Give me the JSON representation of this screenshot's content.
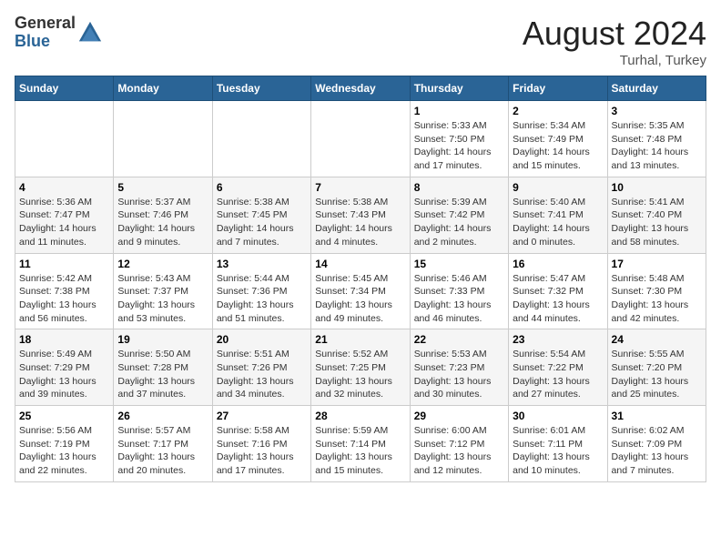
{
  "header": {
    "logo_general": "General",
    "logo_blue": "Blue",
    "month_year": "August 2024",
    "location": "Turhal, Turkey"
  },
  "weekdays": [
    "Sunday",
    "Monday",
    "Tuesday",
    "Wednesday",
    "Thursday",
    "Friday",
    "Saturday"
  ],
  "weeks": [
    [
      {
        "day": "",
        "info": ""
      },
      {
        "day": "",
        "info": ""
      },
      {
        "day": "",
        "info": ""
      },
      {
        "day": "",
        "info": ""
      },
      {
        "day": "1",
        "info": "Sunrise: 5:33 AM\nSunset: 7:50 PM\nDaylight: 14 hours\nand 17 minutes."
      },
      {
        "day": "2",
        "info": "Sunrise: 5:34 AM\nSunset: 7:49 PM\nDaylight: 14 hours\nand 15 minutes."
      },
      {
        "day": "3",
        "info": "Sunrise: 5:35 AM\nSunset: 7:48 PM\nDaylight: 14 hours\nand 13 minutes."
      }
    ],
    [
      {
        "day": "4",
        "info": "Sunrise: 5:36 AM\nSunset: 7:47 PM\nDaylight: 14 hours\nand 11 minutes."
      },
      {
        "day": "5",
        "info": "Sunrise: 5:37 AM\nSunset: 7:46 PM\nDaylight: 14 hours\nand 9 minutes."
      },
      {
        "day": "6",
        "info": "Sunrise: 5:38 AM\nSunset: 7:45 PM\nDaylight: 14 hours\nand 7 minutes."
      },
      {
        "day": "7",
        "info": "Sunrise: 5:38 AM\nSunset: 7:43 PM\nDaylight: 14 hours\nand 4 minutes."
      },
      {
        "day": "8",
        "info": "Sunrise: 5:39 AM\nSunset: 7:42 PM\nDaylight: 14 hours\nand 2 minutes."
      },
      {
        "day": "9",
        "info": "Sunrise: 5:40 AM\nSunset: 7:41 PM\nDaylight: 14 hours\nand 0 minutes."
      },
      {
        "day": "10",
        "info": "Sunrise: 5:41 AM\nSunset: 7:40 PM\nDaylight: 13 hours\nand 58 minutes."
      }
    ],
    [
      {
        "day": "11",
        "info": "Sunrise: 5:42 AM\nSunset: 7:38 PM\nDaylight: 13 hours\nand 56 minutes."
      },
      {
        "day": "12",
        "info": "Sunrise: 5:43 AM\nSunset: 7:37 PM\nDaylight: 13 hours\nand 53 minutes."
      },
      {
        "day": "13",
        "info": "Sunrise: 5:44 AM\nSunset: 7:36 PM\nDaylight: 13 hours\nand 51 minutes."
      },
      {
        "day": "14",
        "info": "Sunrise: 5:45 AM\nSunset: 7:34 PM\nDaylight: 13 hours\nand 49 minutes."
      },
      {
        "day": "15",
        "info": "Sunrise: 5:46 AM\nSunset: 7:33 PM\nDaylight: 13 hours\nand 46 minutes."
      },
      {
        "day": "16",
        "info": "Sunrise: 5:47 AM\nSunset: 7:32 PM\nDaylight: 13 hours\nand 44 minutes."
      },
      {
        "day": "17",
        "info": "Sunrise: 5:48 AM\nSunset: 7:30 PM\nDaylight: 13 hours\nand 42 minutes."
      }
    ],
    [
      {
        "day": "18",
        "info": "Sunrise: 5:49 AM\nSunset: 7:29 PM\nDaylight: 13 hours\nand 39 minutes."
      },
      {
        "day": "19",
        "info": "Sunrise: 5:50 AM\nSunset: 7:28 PM\nDaylight: 13 hours\nand 37 minutes."
      },
      {
        "day": "20",
        "info": "Sunrise: 5:51 AM\nSunset: 7:26 PM\nDaylight: 13 hours\nand 34 minutes."
      },
      {
        "day": "21",
        "info": "Sunrise: 5:52 AM\nSunset: 7:25 PM\nDaylight: 13 hours\nand 32 minutes."
      },
      {
        "day": "22",
        "info": "Sunrise: 5:53 AM\nSunset: 7:23 PM\nDaylight: 13 hours\nand 30 minutes."
      },
      {
        "day": "23",
        "info": "Sunrise: 5:54 AM\nSunset: 7:22 PM\nDaylight: 13 hours\nand 27 minutes."
      },
      {
        "day": "24",
        "info": "Sunrise: 5:55 AM\nSunset: 7:20 PM\nDaylight: 13 hours\nand 25 minutes."
      }
    ],
    [
      {
        "day": "25",
        "info": "Sunrise: 5:56 AM\nSunset: 7:19 PM\nDaylight: 13 hours\nand 22 minutes."
      },
      {
        "day": "26",
        "info": "Sunrise: 5:57 AM\nSunset: 7:17 PM\nDaylight: 13 hours\nand 20 minutes."
      },
      {
        "day": "27",
        "info": "Sunrise: 5:58 AM\nSunset: 7:16 PM\nDaylight: 13 hours\nand 17 minutes."
      },
      {
        "day": "28",
        "info": "Sunrise: 5:59 AM\nSunset: 7:14 PM\nDaylight: 13 hours\nand 15 minutes."
      },
      {
        "day": "29",
        "info": "Sunrise: 6:00 AM\nSunset: 7:12 PM\nDaylight: 13 hours\nand 12 minutes."
      },
      {
        "day": "30",
        "info": "Sunrise: 6:01 AM\nSunset: 7:11 PM\nDaylight: 13 hours\nand 10 minutes."
      },
      {
        "day": "31",
        "info": "Sunrise: 6:02 AM\nSunset: 7:09 PM\nDaylight: 13 hours\nand 7 minutes."
      }
    ]
  ]
}
